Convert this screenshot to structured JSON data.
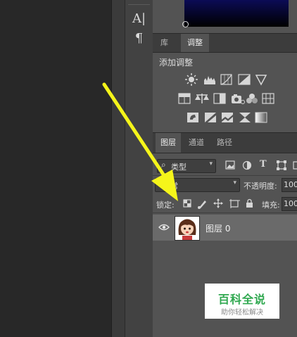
{
  "tool_strip": {
    "text_tool_icon": "A|",
    "paragraph_icon": "¶"
  },
  "top_tabs": {
    "library_label": "库",
    "adjustments_label": "调整"
  },
  "adjustments": {
    "title": "添加调整"
  },
  "layer_tabs": {
    "layers_label": "图层",
    "channels_label": "通道",
    "paths_label": "路径"
  },
  "layers_panel": {
    "filter_icon": "⌕",
    "filter_value": "类型",
    "text_filter_icon": "T",
    "blend_mode_value": "常",
    "opacity_label": "不透明度:",
    "opacity_value": "100",
    "lock_label": "锁定:",
    "fill_label": "填充:",
    "fill_value": "100"
  },
  "layers": [
    {
      "name": "图层 0"
    }
  ],
  "watermark": {
    "title": "百科全说",
    "subtitle": "助你轻松解决"
  },
  "colors": {
    "arrow": "#f5f51a",
    "watermark_green": "#2fa84f",
    "panel": "#535353"
  }
}
